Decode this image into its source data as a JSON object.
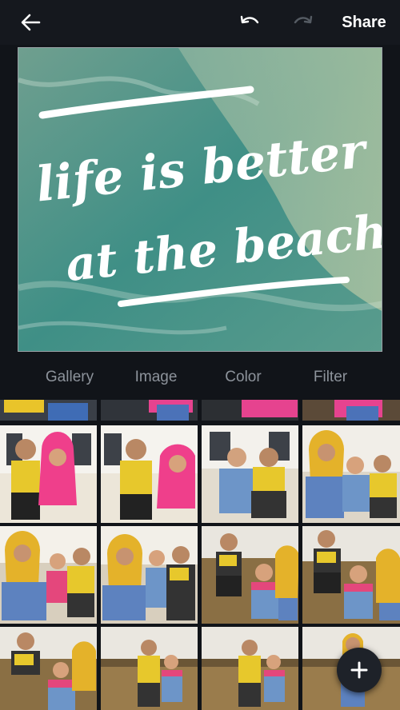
{
  "toolbar": {
    "back_icon": "arrow-left-icon",
    "undo_icon": "undo-icon",
    "redo_icon": "redo-icon",
    "share_label": "Share"
  },
  "design": {
    "line1": "life is better",
    "line2": "at the beach"
  },
  "tabs": [
    {
      "label": "Gallery"
    },
    {
      "label": "Image"
    },
    {
      "label": "Color"
    },
    {
      "label": "Filter"
    }
  ],
  "fab": {
    "icon": "plus-icon"
  }
}
